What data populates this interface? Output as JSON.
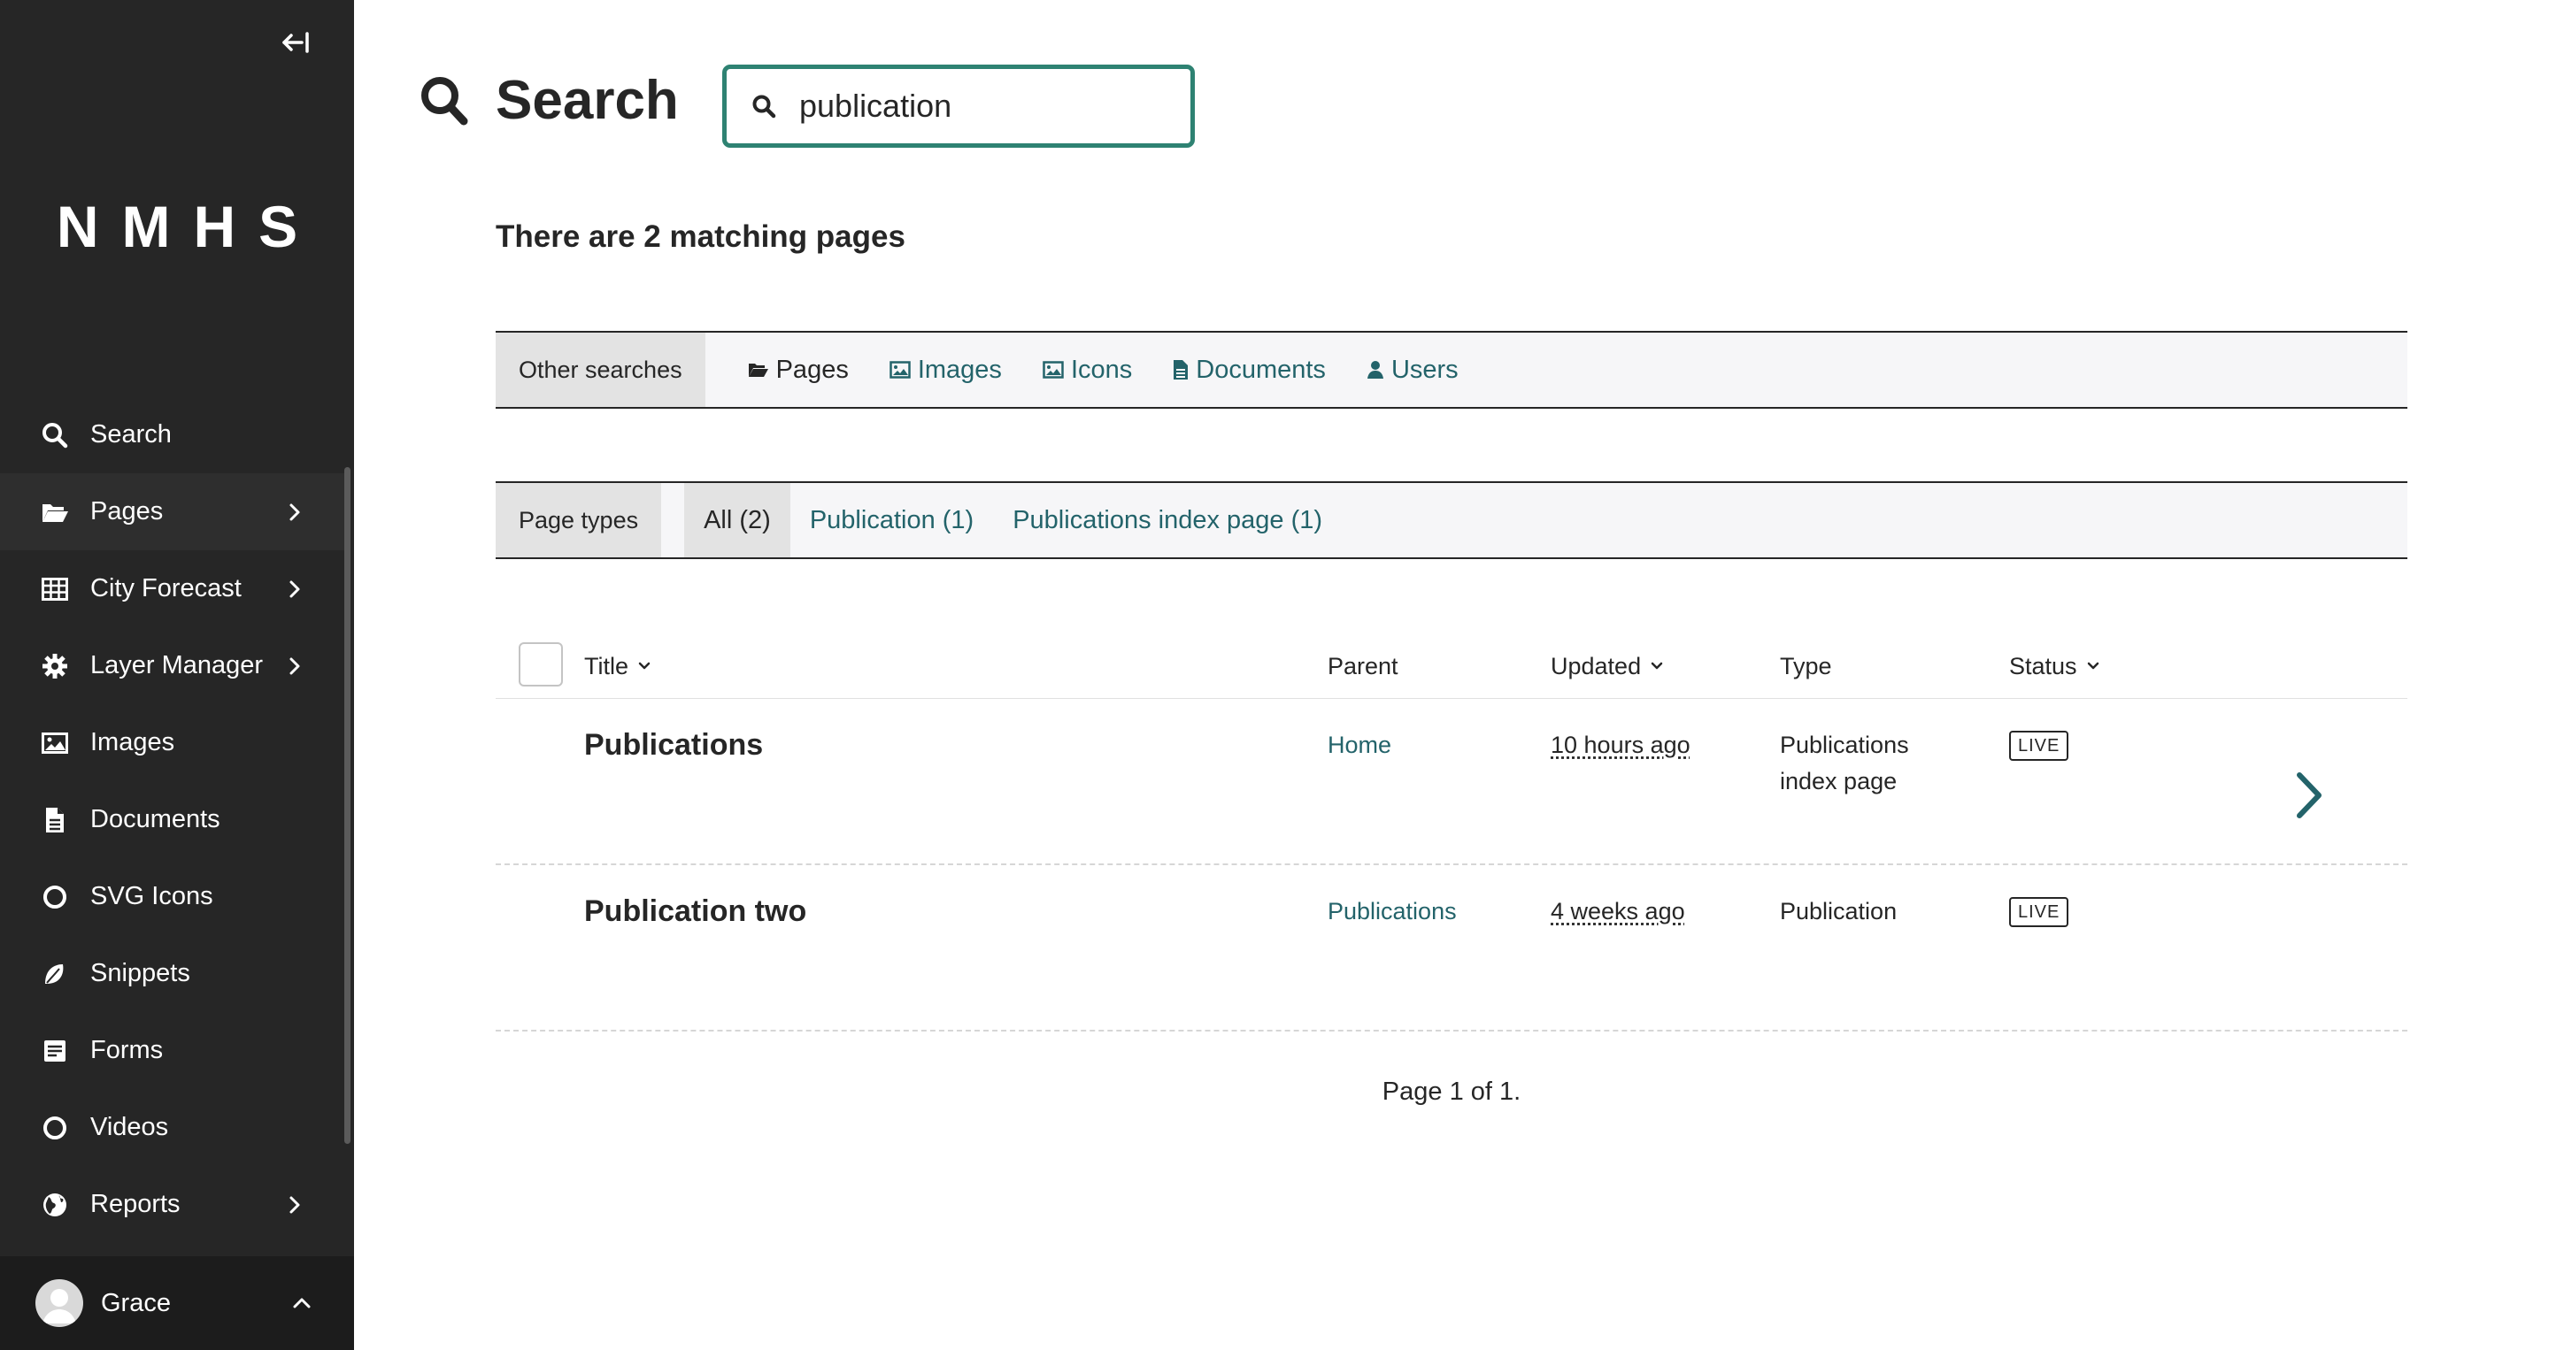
{
  "sidebar": {
    "collapse_label": "Collapse sidebar",
    "logo": "NMHS",
    "items": [
      {
        "label": "Search",
        "icon": "search-icon"
      },
      {
        "label": "Pages",
        "icon": "folder-open-icon",
        "has_submenu": true
      },
      {
        "label": "City Forecast",
        "icon": "table-icon",
        "has_submenu": true
      },
      {
        "label": "Layer Manager",
        "icon": "cog-icon",
        "has_submenu": true
      },
      {
        "label": "Images",
        "icon": "image-icon"
      },
      {
        "label": "Documents",
        "icon": "document-icon"
      },
      {
        "label": "SVG Icons",
        "icon": "circle-icon"
      },
      {
        "label": "Snippets",
        "icon": "snippet-icon"
      },
      {
        "label": "Forms",
        "icon": "form-icon"
      },
      {
        "label": "Videos",
        "icon": "circle-icon"
      },
      {
        "label": "Reports",
        "icon": "globe-icon",
        "has_submenu": true
      }
    ],
    "user": {
      "name": "Grace"
    }
  },
  "header": {
    "title": "Search",
    "search_value": "publication"
  },
  "results_count": "There are 2 matching pages",
  "other_searches": {
    "label": "Other searches",
    "links": [
      {
        "label": "Pages",
        "icon": "folder-icon"
      },
      {
        "label": "Images",
        "icon": "image-icon"
      },
      {
        "label": "Icons",
        "icon": "image-icon"
      },
      {
        "label": "Documents",
        "icon": "document-icon"
      },
      {
        "label": "Users",
        "icon": "user-icon"
      }
    ]
  },
  "page_types": {
    "label": "Page types",
    "tabs": [
      "All (2)",
      "Publication (1)",
      "Publications index page (1)"
    ],
    "active_tab": "All (2)"
  },
  "table": {
    "columns": {
      "title": "Title",
      "parent": "Parent",
      "updated": "Updated",
      "type": "Type",
      "status": "Status"
    },
    "rows": [
      {
        "title": "Publications",
        "parent": "Home",
        "updated": "10 hours ago",
        "type_line1": "Publications",
        "type_line2": "index page",
        "status": "LIVE"
      },
      {
        "title": "Publication two",
        "parent": "Publications",
        "updated": "4 weeks ago",
        "type_line1": "Publication",
        "type_line2": "",
        "status": "LIVE"
      }
    ]
  },
  "pagination": "Page 1 of 1.",
  "colors": {
    "sidebar_bg": "#262626",
    "accent": "#2e8272",
    "link": "#23636a"
  }
}
